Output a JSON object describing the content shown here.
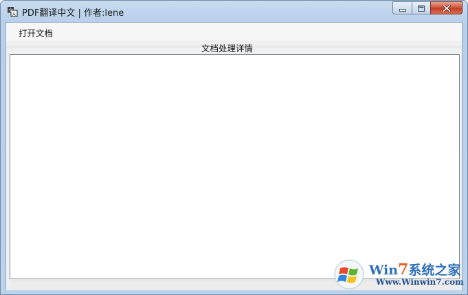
{
  "window": {
    "title": "PDF翻译中文 | 作者:lene",
    "controls": [
      "minimize-icon",
      "maximize-icon",
      "close-icon"
    ]
  },
  "menu": {
    "open_document": "打开文档"
  },
  "details_group": {
    "label": "文档处理详情",
    "log_text": ""
  },
  "watermark": {
    "brand_prefix": "Win",
    "brand_seven": "7",
    "brand_suffix": "系统之家",
    "url": "Www.Winwin7.com"
  },
  "colors": {
    "title_bar": "#bcd3ec",
    "close_button": "#c23b22",
    "client_background": "#f0f0f0",
    "watermark_blue": "#2d6fb8",
    "watermark_orange": "#e8622a"
  }
}
